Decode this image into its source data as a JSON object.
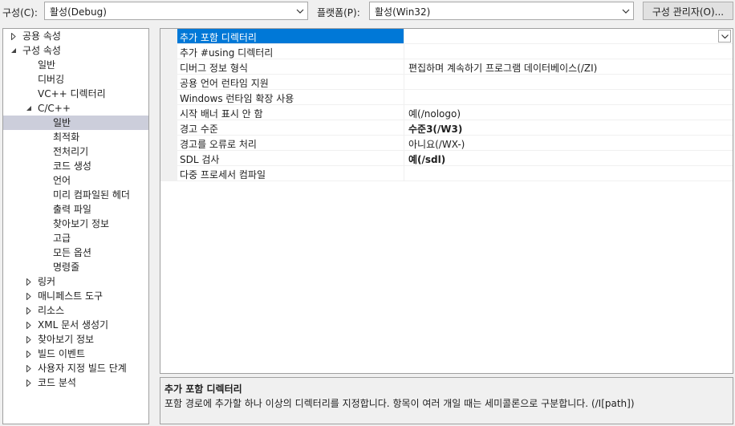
{
  "toolbar": {
    "config_label": "구성(C):",
    "config_value": "활성(Debug)",
    "platform_label": "플랫폼(P):",
    "platform_value": "활성(Win32)",
    "manager_button": "구성 관리자(O)..."
  },
  "tree": [
    {
      "label": "공용 속성",
      "level": 0,
      "state": "collapsed"
    },
    {
      "label": "구성 속성",
      "level": 0,
      "state": "expanded"
    },
    {
      "label": "일반",
      "level": 1,
      "state": "leaf"
    },
    {
      "label": "디버깅",
      "level": 1,
      "state": "leaf"
    },
    {
      "label": "VC++ 디렉터리",
      "level": 1,
      "state": "leaf"
    },
    {
      "label": "C/C++",
      "level": 1,
      "state": "expanded"
    },
    {
      "label": "일반",
      "level": 2,
      "state": "leaf",
      "selected": true
    },
    {
      "label": "최적화",
      "level": 2,
      "state": "leaf"
    },
    {
      "label": "전처리기",
      "level": 2,
      "state": "leaf"
    },
    {
      "label": "코드 생성",
      "level": 2,
      "state": "leaf"
    },
    {
      "label": "언어",
      "level": 2,
      "state": "leaf"
    },
    {
      "label": "미리 컴파일된 헤더",
      "level": 2,
      "state": "leaf"
    },
    {
      "label": "출력 파일",
      "level": 2,
      "state": "leaf"
    },
    {
      "label": "찾아보기 정보",
      "level": 2,
      "state": "leaf"
    },
    {
      "label": "고급",
      "level": 2,
      "state": "leaf"
    },
    {
      "label": "모든 옵션",
      "level": 2,
      "state": "leaf"
    },
    {
      "label": "명령줄",
      "level": 2,
      "state": "leaf"
    },
    {
      "label": "링커",
      "level": 1,
      "state": "collapsed"
    },
    {
      "label": "매니페스트 도구",
      "level": 1,
      "state": "collapsed"
    },
    {
      "label": "리소스",
      "level": 1,
      "state": "collapsed"
    },
    {
      "label": "XML 문서 생성기",
      "level": 1,
      "state": "collapsed"
    },
    {
      "label": "찾아보기 정보",
      "level": 1,
      "state": "collapsed"
    },
    {
      "label": "빌드 이벤트",
      "level": 1,
      "state": "collapsed"
    },
    {
      "label": "사용자 지정 빌드 단계",
      "level": 1,
      "state": "collapsed"
    },
    {
      "label": "코드 분석",
      "level": 1,
      "state": "collapsed"
    }
  ],
  "properties": [
    {
      "name": "추가 포함 디렉터리",
      "value": "",
      "selected": true,
      "bold": false
    },
    {
      "name": "추가 #using 디렉터리",
      "value": "",
      "bold": false
    },
    {
      "name": "디버그 정보 형식",
      "value": "편집하며 계속하기 프로그램 데이터베이스(/ZI)",
      "bold": false
    },
    {
      "name": "공용 언어 런타임 지원",
      "value": "",
      "bold": false
    },
    {
      "name": "Windows 런타임 확장 사용",
      "value": "",
      "bold": false
    },
    {
      "name": "시작 배너 표시 안 함",
      "value": "예(/nologo)",
      "bold": false
    },
    {
      "name": "경고 수준",
      "value": "수준3(/W3)",
      "bold": true
    },
    {
      "name": "경고를 오류로 처리",
      "value": "아니요(/WX-)",
      "bold": false
    },
    {
      "name": "SDL 검사",
      "value": "예(/sdl)",
      "bold": true
    },
    {
      "name": "다중 프로세서 컴파일",
      "value": "",
      "bold": false
    }
  ],
  "description": {
    "title": "추가 포함 디렉터리",
    "text": "포함 경로에 추가할 하나 이상의 디렉터리를 지정합니다. 항목이 여러 개일 때는 세미콜론으로 구분합니다.      (/I[path])"
  },
  "colors": {
    "selection_blue": "#0078d7",
    "tree_selection": "#cccedb",
    "background": "#f0f0f0"
  }
}
